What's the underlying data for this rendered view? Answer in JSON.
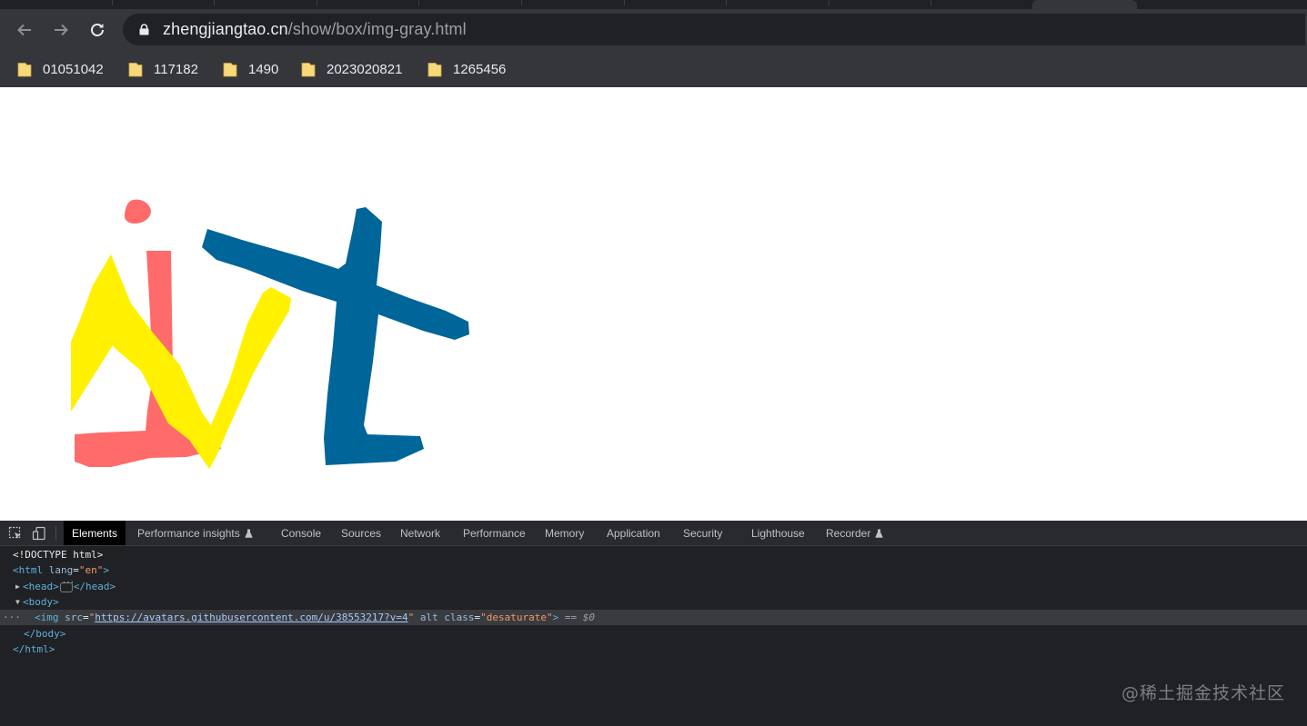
{
  "browser": {
    "url_host": "zhengjiangtao.cn",
    "url_path": "/show/box/img-gray.html",
    "bookmarks": [
      {
        "label": "01051042"
      },
      {
        "label": "117182"
      },
      {
        "label": "1490"
      },
      {
        "label": "2023020821"
      },
      {
        "label": "1265456"
      }
    ]
  },
  "devtools": {
    "tabs": [
      {
        "label": "Elements",
        "active": true
      },
      {
        "label": "Performance insights",
        "experimental": true
      },
      {
        "label": "Console"
      },
      {
        "label": "Sources"
      },
      {
        "label": "Network"
      },
      {
        "label": "Performance"
      },
      {
        "label": "Memory"
      },
      {
        "label": "Application"
      },
      {
        "label": "Security"
      },
      {
        "label": "Lighthouse"
      },
      {
        "label": "Recorder",
        "experimental": true
      }
    ],
    "dom": {
      "doctype": "<!DOCTYPE html>",
      "html_open": "<html",
      "html_attr": "lang",
      "html_attr_val": "\"en\"",
      "head_open": "<head>",
      "head_close": "</head>",
      "body_open": "<body>",
      "img_open": "<img",
      "img_src_attr": "src",
      "img_src_val": "https://avatars.githubusercontent.com/u/38553217?v=4",
      "img_alt_attr": "alt",
      "img_class_attr": "class",
      "img_class_val": "\"desaturate\"",
      "img_selected_marker": "== $0",
      "body_close": "</body>",
      "html_close": "</html>"
    }
  },
  "watermark": "@稀土掘金技术社区",
  "colors": {
    "logo_red": "#ff6b6b",
    "logo_yellow": "#fff100",
    "logo_blue": "#006599"
  }
}
